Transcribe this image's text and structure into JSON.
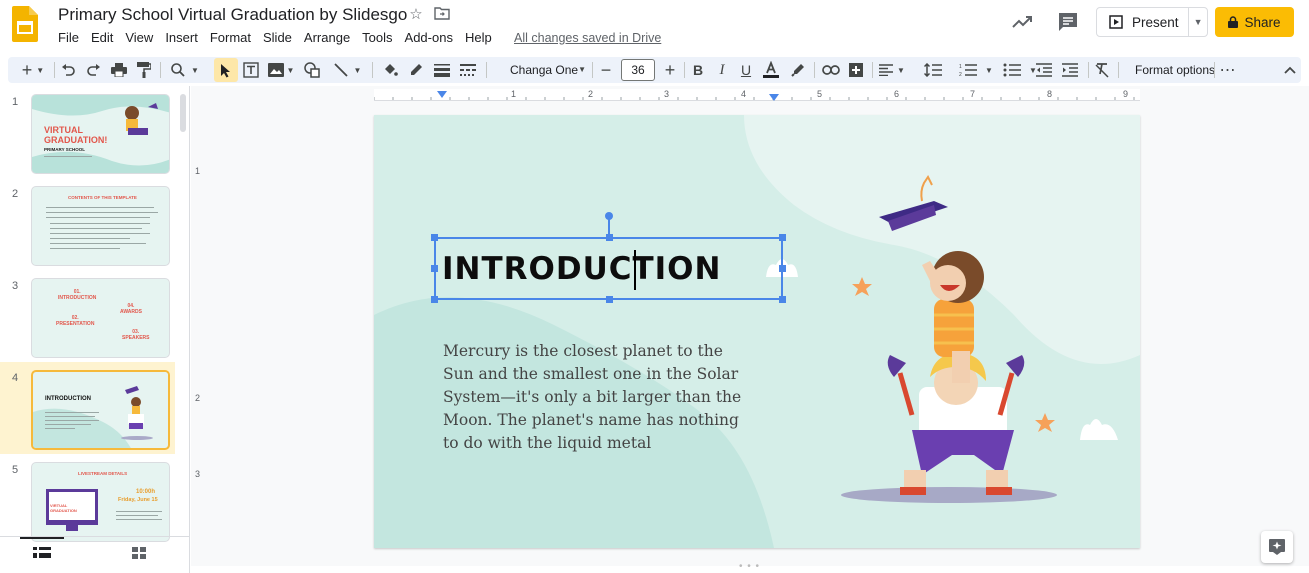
{
  "app": {
    "doc_title": "Primary School Virtual Graduation by Slidesgo",
    "saved_status": "All changes saved in Drive"
  },
  "menu": [
    "File",
    "Edit",
    "View",
    "Insert",
    "Format",
    "Slide",
    "Arrange",
    "Tools",
    "Add-ons",
    "Help"
  ],
  "header_buttons": {
    "present_label": "Present",
    "share_label": "Share"
  },
  "toolbar": {
    "font_name": "Changa One",
    "font_size": "36",
    "format_options_label": "Format options"
  },
  "filmstrip": {
    "slides": [
      {
        "number": "1",
        "title_line1": "VIRTUAL",
        "title_line2": "GRADUATION!",
        "subtitle": "PRIMARY SCHOOL"
      },
      {
        "number": "2",
        "title_line1": "CONTENTS OF THIS TEMPLATE"
      },
      {
        "number": "3",
        "title_line1": "01.",
        "title_line2": "INTRODUCTION",
        "item2": "02.",
        "item2_label": "PRESENTATION",
        "item3": "03.",
        "item3_label": "SPEAKERS",
        "item4": "04.",
        "item4_label": "AWARDS"
      },
      {
        "number": "4",
        "title_line1": "INTRODUCTION"
      },
      {
        "number": "5",
        "title_line1": "LIVESTREAM DETAILS",
        "time": "10:00h",
        "date": "Friday, June 15",
        "screen_title": "VIRTUAL GRADUATION"
      }
    ],
    "selected_index": 3
  },
  "ruler": {
    "h_ticks": [
      "1",
      "2",
      "3",
      "4",
      "5",
      "6",
      "7",
      "8",
      "9"
    ],
    "v_ticks": [
      "1",
      "2",
      "3"
    ]
  },
  "slide": {
    "title": "INTRODUCTION",
    "body": "Mercury is the closest planet to the Sun and the smallest one in the Solar System—it's only a bit larger than the Moon. The planet's name has nothing to do with the liquid metal"
  },
  "colors": {
    "accent_share": "#fbbc04",
    "selection_blue": "#4a86e8",
    "slide_bg": "#d5eee8",
    "toolbar_bg": "#edf2fa",
    "thumb_selected_border": "#f6b93b"
  }
}
